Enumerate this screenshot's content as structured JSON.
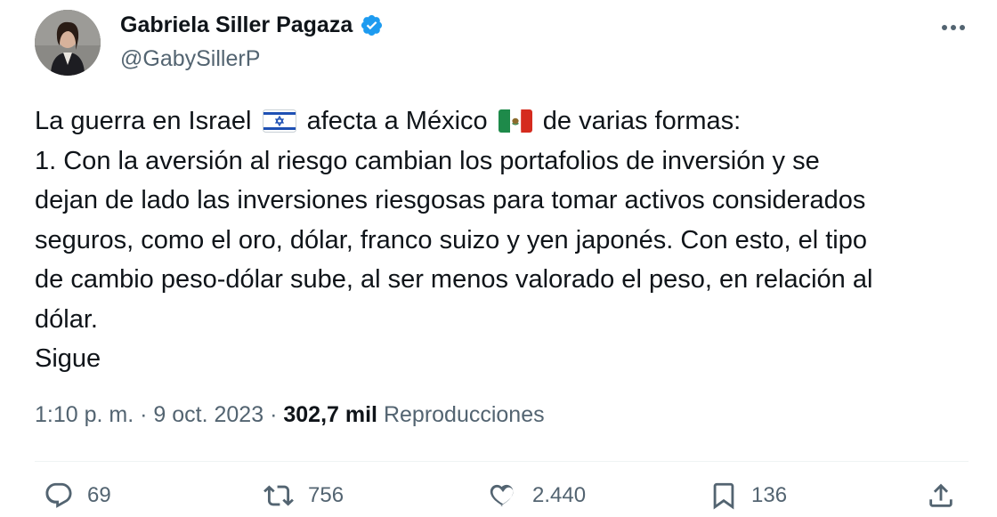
{
  "author": {
    "name": "Gabriela Siller Pagaza",
    "handle": "@GabySillerP",
    "avatar_icon": "profile-photo",
    "verified_icon": "verified-badge-icon",
    "verified_color": "#1d9bf0"
  },
  "more_icon": "more-horizontal-icon",
  "tweet": {
    "line1_part1": "La guerra en Israel",
    "line1_part2": "afecta a México",
    "line1_part3": "de varias formas:",
    "line2": "1. Con la aversión al riesgo cambian los portafolios de inversión y se",
    "line3": "dejan de lado las inversiones riesgosas para tomar activos considerados",
    "line4": "seguros, como el oro, dólar, franco suizo y yen japonés. Con esto, el tipo",
    "line5": "de cambio peso-dólar sube, al ser menos valorado el peso, en relación al",
    "line6": "dólar.",
    "line7": "Sigue",
    "flags": [
      "israel-flag-emoji",
      "mexico-flag-emoji"
    ]
  },
  "meta": {
    "time": "1:10 p. m.",
    "sep1": "·",
    "date": "9 oct. 2023",
    "sep2": "·",
    "views_count": "302,7 mil",
    "views_label": "Reproducciones"
  },
  "actions": {
    "replies": "69",
    "reposts": "756",
    "likes": "2.440",
    "bookmarks": "136",
    "icons": [
      "reply-icon",
      "repost-icon",
      "like-icon",
      "bookmark-icon",
      "share-icon"
    ]
  },
  "colors": {
    "text": "#0f1419",
    "secondary": "#536471",
    "divider": "#eff3f4"
  }
}
